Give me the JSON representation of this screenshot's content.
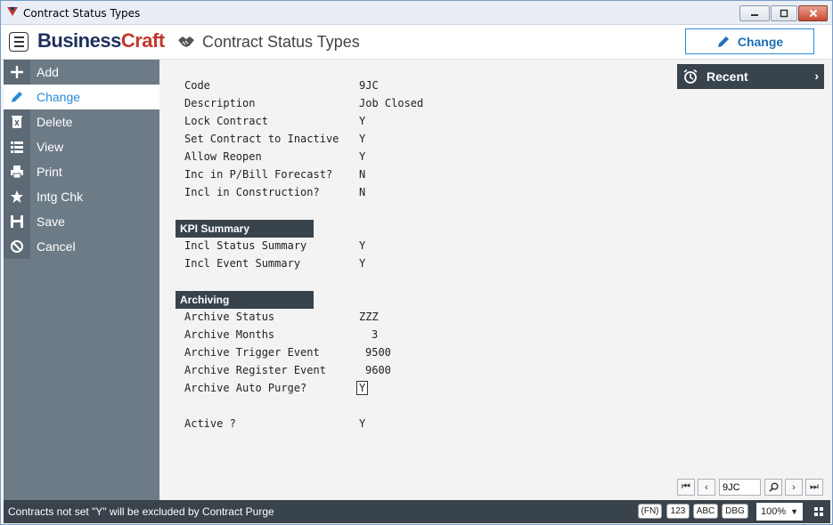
{
  "window": {
    "title": "Contract Status Types"
  },
  "header": {
    "logo_part1": "Business",
    "logo_part2": "Craft",
    "page_title": "Contract Status Types",
    "change_label": "Change"
  },
  "sidebar": {
    "items": [
      {
        "label": "Add",
        "icon": "plus-icon"
      },
      {
        "label": "Change",
        "icon": "pencil-icon"
      },
      {
        "label": "Delete",
        "icon": "trash-icon"
      },
      {
        "label": "View",
        "icon": "list-icon"
      },
      {
        "label": "Print",
        "icon": "printer-icon"
      },
      {
        "label": "Intg Chk",
        "icon": "star-icon"
      },
      {
        "label": "Save",
        "icon": "save-icon"
      },
      {
        "label": "Cancel",
        "icon": "cancel-icon"
      }
    ]
  },
  "recent": {
    "label": "Recent"
  },
  "fields": {
    "code": {
      "label": "Code",
      "value": "9JC"
    },
    "description": {
      "label": "Description",
      "value": "Job Closed"
    },
    "lock_contract": {
      "label": "Lock Contract",
      "value": "Y"
    },
    "set_inactive": {
      "label": "Set Contract to Inactive",
      "value": "Y"
    },
    "allow_reopen": {
      "label": "Allow Reopen",
      "value": "Y"
    },
    "inc_pbill": {
      "label": "Inc in P/Bill Forecast?",
      "value": "N"
    },
    "incl_construction": {
      "label": "Incl in Construction?",
      "value": "N"
    }
  },
  "kpi": {
    "title": "KPI Summary",
    "status_summary": {
      "label": "Incl Status Summary",
      "value": "Y"
    },
    "event_summary": {
      "label": "Incl Event Summary",
      "value": "Y"
    }
  },
  "archiving": {
    "title": "Archiving",
    "status": {
      "label": "Archive Status",
      "value": "ZZZ"
    },
    "months": {
      "label": "Archive Months",
      "value": "3"
    },
    "trigger_event": {
      "label": "Archive Trigger Event",
      "value": "9500"
    },
    "register_event": {
      "label": "Archive Register Event",
      "value": "9600"
    },
    "auto_purge": {
      "label": "Archive Auto Purge?",
      "value": "Y"
    }
  },
  "active": {
    "label": "Active ?",
    "value": "Y"
  },
  "pager": {
    "current": "9JC"
  },
  "status": {
    "message": "Contracts not set \"Y\" will be excluded by Contract Purge",
    "fn": "(FN)",
    "num": "123",
    "abc": "ABC",
    "dbg": "DBG",
    "zoom": "100%"
  },
  "colors": {
    "accent": "#2a8bd6",
    "sidebar": "#6d7b87",
    "dark": "#39434c",
    "brand_red": "#c0392b",
    "brand_navy": "#1e2f5c"
  }
}
